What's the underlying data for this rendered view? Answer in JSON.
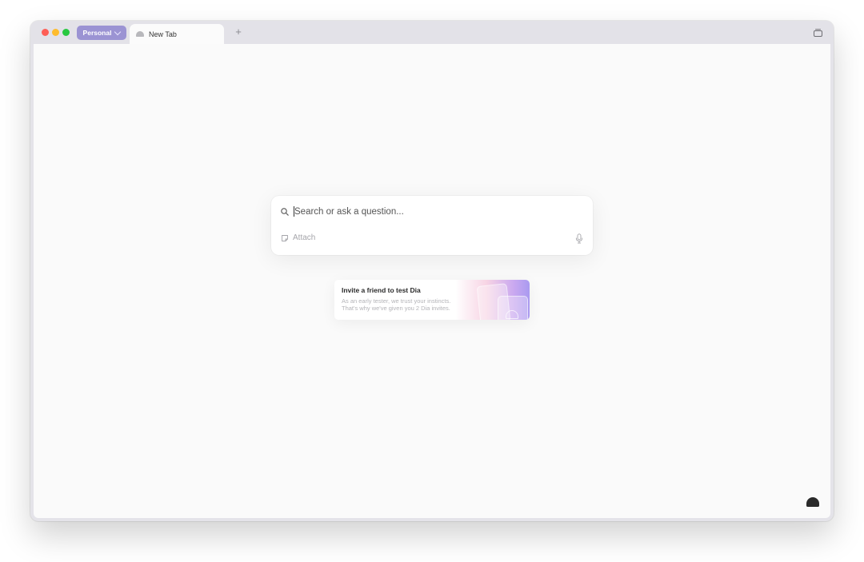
{
  "titlebar": {
    "profile_label": "Personal",
    "tab_label": "New Tab",
    "new_tab_label": "+"
  },
  "search": {
    "placeholder": "Search or ask a question...",
    "attach_label": "Attach"
  },
  "invite": {
    "title": "Invite a friend to test Dia",
    "line1": "As an early tester, we trust your instincts.",
    "line2": "That's why we've given you 2 Dia invites."
  },
  "colors": {
    "accent": "#9b93d3",
    "close": "#fe5f57",
    "minimize": "#febc2e",
    "maximize": "#28c840"
  },
  "icons": [
    "search-icon",
    "attach-icon",
    "microphone-icon",
    "tabs-overview-icon",
    "dia-logo-icon",
    "chevron-down-icon"
  ]
}
